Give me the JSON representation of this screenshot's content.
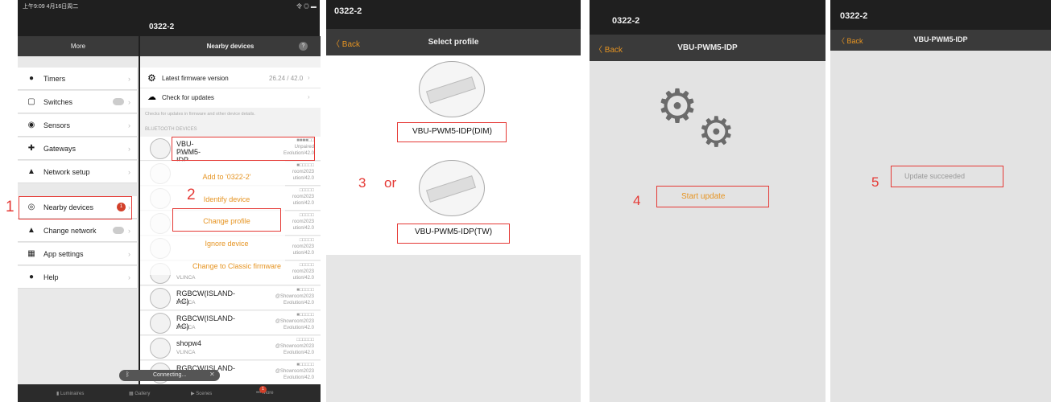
{
  "panel1": {
    "status_time": "上午9:09  4月16日周二",
    "status_right": "令 ◎ ▬",
    "window_title": "0322-2",
    "left_header": "More",
    "right_header": "Nearby devices",
    "menu": [
      {
        "label": "Timers",
        "icon": "clock-icon"
      },
      {
        "label": "Switches",
        "icon": "switch-icon"
      },
      {
        "label": "Sensors",
        "icon": "sensor-icon"
      },
      {
        "label": "Gateways",
        "icon": "gateway-icon"
      },
      {
        "label": "Network setup",
        "icon": "network-icon"
      },
      {
        "label": "Nearby devices",
        "icon": "bluetooth-icon"
      },
      {
        "label": "Change network",
        "icon": "network-icon"
      },
      {
        "label": "App settings",
        "icon": "settings-icon"
      },
      {
        "label": "Help",
        "icon": "info-icon"
      }
    ],
    "firmware": {
      "label": "Latest firmware version",
      "value": "26.24 / 42.0"
    },
    "check_updates": "Check for updates",
    "check_hint": "Checks for updates in firmware and other device details.",
    "section_label": "BLUETOOTH DEVICES",
    "devices": [
      {
        "name": "VBU-PWM5-IDP",
        "vendor": "VLINCA",
        "r1": "■■■■□□",
        "r2": "Unpaired",
        "r3": "Evolution/42.0"
      },
      {
        "name": "",
        "vendor": "",
        "r1": "■□□□□□",
        "r2": "room2023",
        "r3": "ution/42.0"
      },
      {
        "name": "",
        "vendor": "",
        "r1": "□□□□□",
        "r2": "room2023",
        "r3": "ution/42.0"
      },
      {
        "name": "",
        "vendor": "",
        "r1": "□□□□□",
        "r2": "room2023",
        "r3": "ution/42.0"
      },
      {
        "name": "",
        "vendor": "",
        "r1": "□□□□□",
        "r2": "room2023",
        "r3": "ution/42.0"
      },
      {
        "name": "",
        "vendor": "VLINCA",
        "r1": "□□□□□",
        "r2": "room2023",
        "r3": "ution/42.0"
      },
      {
        "name": "RGBCW(ISLAND-AC)",
        "vendor": "VLINCA",
        "r1": "■□□□□□",
        "r2": "@Showroom2023",
        "r3": "Evolution/42.0"
      },
      {
        "name": "RGBCW(ISLAND-AC)",
        "vendor": "VLINCA",
        "r1": "■□□□□□",
        "r2": "@Showroom2023",
        "r3": "Evolution/42.0"
      },
      {
        "name": "shopw4",
        "vendor": "VLINCA",
        "r1": "□□□□□□",
        "r2": "@Showroom2023",
        "r3": "Evolution/42.0"
      },
      {
        "name": "RGBCW(ISLAND-AC)",
        "vendor": "VLINCA",
        "r1": "■□□□□□",
        "r2": "@Showroom2023",
        "r3": "Evolution/42.0"
      }
    ],
    "actions": [
      "Add to '0322-2'",
      "Identify device",
      "Change profile",
      "Ignore device",
      "Change to Classic firmware"
    ],
    "connecting": "Connecting...",
    "tabs": [
      "Luminaires",
      "Gallery",
      "Scenes",
      "More"
    ],
    "badge": "1"
  },
  "panel2": {
    "window_title": "0322-2",
    "back": "Back",
    "title": "Select profile",
    "profile_dim": "VBU-PWM5-IDP(DIM)",
    "profile_tw": "VBU-PWM5-IDP(TW)"
  },
  "panel3": {
    "window_title": "0322-2",
    "back": "Back",
    "title": "VBU-PWM5-IDP",
    "start_update": "Start update"
  },
  "panel4": {
    "window_title": "0322-2",
    "back": "Back",
    "title": "VBU-PWM5-IDP",
    "result": "Update succeeded"
  },
  "annotations": {
    "step1": "1",
    "step2": "2",
    "step3": "3",
    "or": "or",
    "step4": "4",
    "step5": "5"
  },
  "colors": {
    "accent": "#e69422",
    "annotation": "#e53935",
    "badge": "#d2402a"
  }
}
